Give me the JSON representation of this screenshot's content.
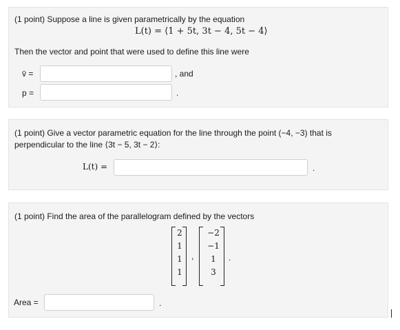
{
  "problem1": {
    "prompt": "(1 point) Suppose a line is given parametrically by the equation",
    "equation": "L(t) = ⟨1 + 5t, 3t − 4, 5t − 4⟩",
    "instruction": "Then the vector and point that were used to define this line were",
    "v_label": "v̄ =",
    "v_value": "",
    "and_text": ", and",
    "p_label": "p =",
    "p_value": "",
    "period": "."
  },
  "problem2": {
    "prompt_line1": "(1 point) Give a vector parametric equation for the line through the point (−4, −3) that is",
    "prompt_line2": "perpendicular to the line ⟨3t − 5, 3t − 2⟩:",
    "l_label": "L(t) =",
    "l_value": "",
    "period": "."
  },
  "problem3": {
    "prompt": "(1 point) Find the area of the parallelogram defined by the vectors",
    "vector1": [
      "2",
      "1",
      "1",
      "1"
    ],
    "vector2": [
      "−2",
      "−1",
      "1",
      "3"
    ],
    "comma": ",",
    "period": ".",
    "area_label": "Area =",
    "area_value": "",
    "area_period": "."
  }
}
